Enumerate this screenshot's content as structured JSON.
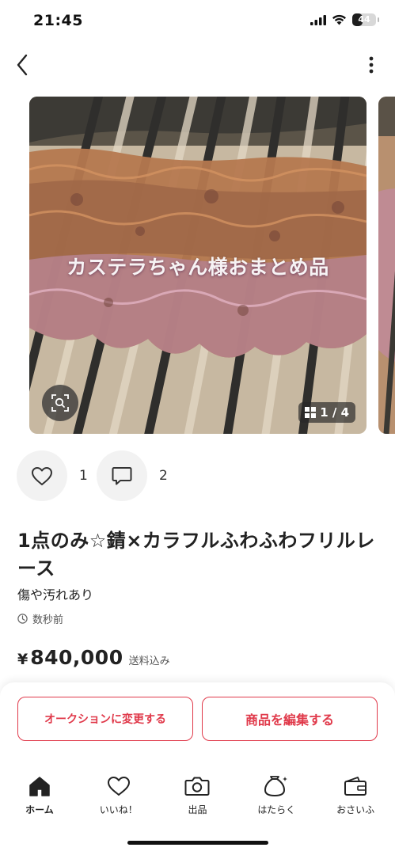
{
  "status_bar": {
    "time": "21:45",
    "battery_level": "44"
  },
  "nav": {
    "back_icon": "chevron-left-icon",
    "more_icon": "vertical-ellipsis-icon"
  },
  "photo": {
    "overlay_text": "カステラちゃん様おまとめ品",
    "counter": "1 / 4",
    "zoom_icon": "scan-zoom-icon",
    "counter_icon": "grid-icon"
  },
  "reactions": {
    "likes": "1",
    "comments": "2"
  },
  "item": {
    "title": "1点のみ☆錆×カラフルふわふわフリルレース",
    "condition": "傷や汚れあり",
    "time": "数秒前",
    "currency": "¥",
    "price": "840,000",
    "shipping": "送料込み"
  },
  "actions": {
    "auction_label": "オークションに変更する",
    "edit_label": "商品を編集する"
  },
  "tabs": [
    {
      "label": "ホーム",
      "icon": "home-icon"
    },
    {
      "label": "いいね！",
      "icon": "heart-icon"
    },
    {
      "label": "出品",
      "icon": "camera-icon"
    },
    {
      "label": "はたらく",
      "icon": "money-bag-icon"
    },
    {
      "label": "おさいふ",
      "icon": "wallet-icon"
    }
  ],
  "colors": {
    "accent": "#e0394a",
    "text": "#222222"
  }
}
